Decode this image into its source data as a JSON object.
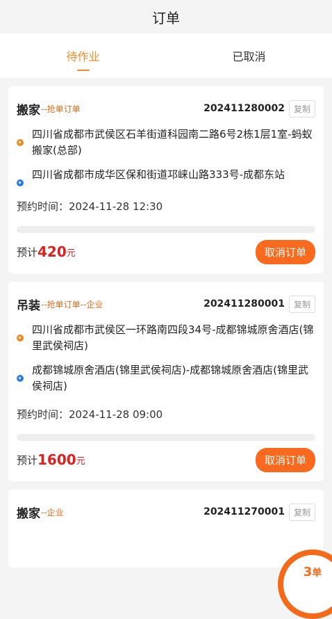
{
  "header": {
    "title": "订单"
  },
  "tabs": [
    {
      "label": "待作业",
      "active": true
    },
    {
      "label": "已取消",
      "active": false
    }
  ],
  "orders": [
    {
      "service": "搬家",
      "tags": "--抢单订单",
      "order_no": "202411280002",
      "copy_label": "复制",
      "from": "四川省成都市武侯区石羊街道科园南二路6号2栋1层1室-蚂蚁搬家(总部)",
      "to": "四川省成都市成华区保和街道邛崃山路333号-成都东站",
      "time_label": "预约时间：",
      "time": "2024-11-28 12:30",
      "est_label": "预计",
      "price": "420",
      "unit": "元",
      "cancel_label": "取消订单"
    },
    {
      "service": "吊装",
      "tags": "--抢单订单--企业",
      "order_no": "202411280001",
      "copy_label": "复制",
      "from": "四川省成都市武侯区一环路南四段34号-成都锦城原舍酒店(锦里武侯祠店)",
      "to": "成都锦城原舍酒店(锦里武侯祠店)-成都锦城原舍酒店(锦里武侯祠店)",
      "time_label": "预约时间：",
      "time": "2024-11-28 09:00",
      "est_label": "预计",
      "price": "1600",
      "unit": "元",
      "cancel_label": "取消订单"
    },
    {
      "service": "搬家",
      "tags": "--企业",
      "order_no": "202411270001",
      "copy_label": "复制"
    }
  ],
  "float_badge": {
    "count": "3",
    "unit": "单"
  },
  "colors": {
    "accent": "#f08a24",
    "price": "#e02020",
    "button": "#fa6a1e",
    "from_dot": "#f08a24",
    "to_dot": "#2b7ce9"
  }
}
